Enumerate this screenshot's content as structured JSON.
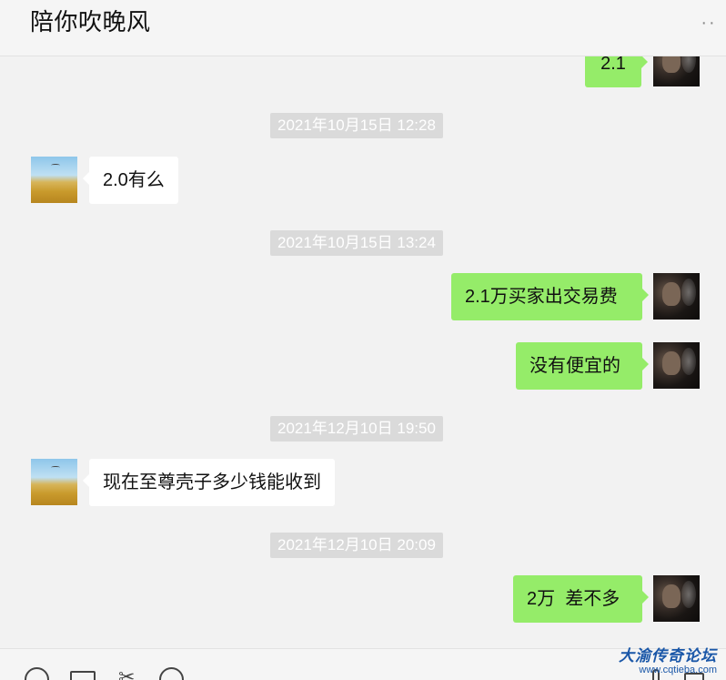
{
  "header": {
    "title": "陪你吹晚风",
    "more_label": "··"
  },
  "messages": [
    {
      "type": "text",
      "direction": "out",
      "text": "2.1"
    },
    {
      "type": "timestamp",
      "text": "2021年10月15日 12:28"
    },
    {
      "type": "text",
      "direction": "in",
      "text": "2.0有么"
    },
    {
      "type": "timestamp",
      "text": "2021年10月15日 13:24"
    },
    {
      "type": "text",
      "direction": "out",
      "text": "2.1万买家出交易费"
    },
    {
      "type": "text",
      "direction": "out",
      "text": "没有便宜的"
    },
    {
      "type": "timestamp",
      "text": "2021年12月10日 19:50"
    },
    {
      "type": "text",
      "direction": "in",
      "text": "现在至尊壳子多少钱能收到"
    },
    {
      "type": "timestamp",
      "text": "2021年12月10日 20:09"
    },
    {
      "type": "text",
      "direction": "out",
      "text": "2万  差不多"
    }
  ],
  "avatars": {
    "contact": "field-landscape-avatar",
    "self": "smoking-man-avatar"
  },
  "footer": {
    "icons": [
      "emoji-icon",
      "folder-icon",
      "scissors-icon",
      "chat-history-icon",
      "microphone-icon",
      "video-call-icon"
    ]
  },
  "watermark": {
    "name": "大渝传奇论坛",
    "url": "www.cqtieba.com"
  },
  "colors": {
    "background": "#f2f2f2",
    "out_bubble": "#95ec69",
    "in_bubble": "#ffffff",
    "timestamp_bg": "#dadada",
    "watermark": "#1a57a8"
  }
}
